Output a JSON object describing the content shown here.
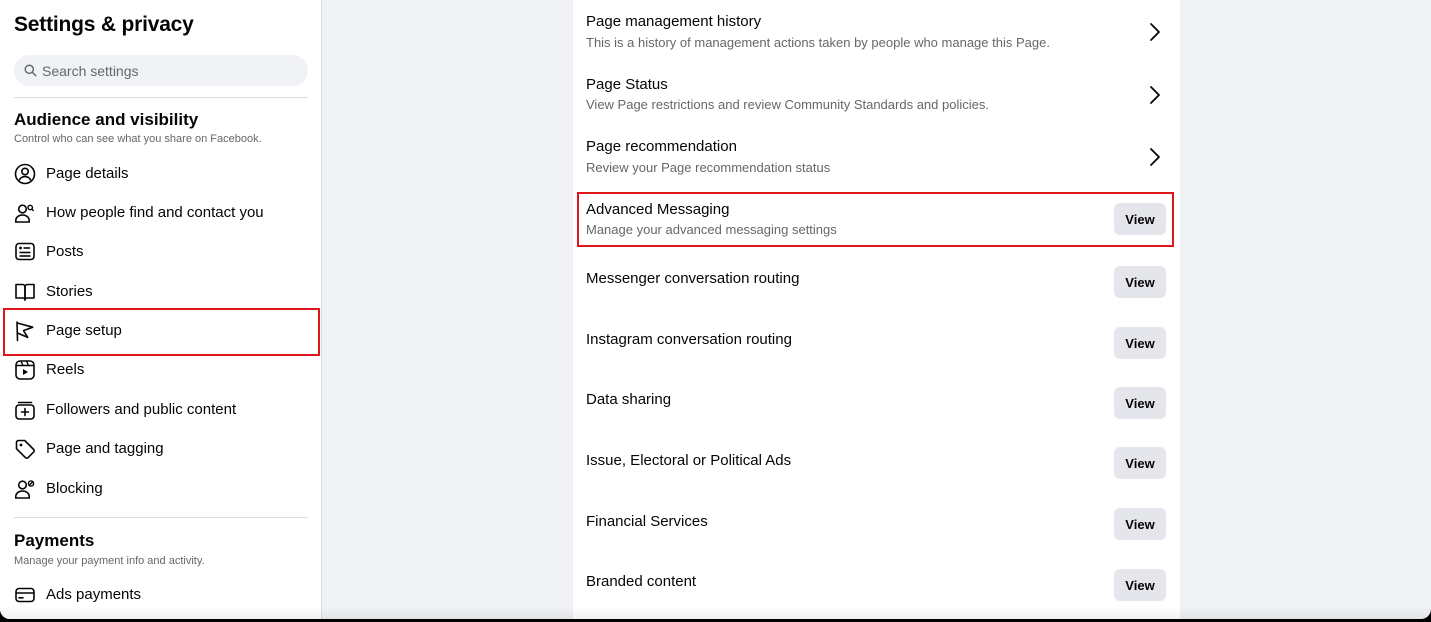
{
  "sidebar": {
    "title": "Settings & privacy",
    "search_placeholder": "Search settings",
    "sections": [
      {
        "title": "Audience and visibility",
        "subtitle": "Control who can see what you share on Facebook.",
        "items": [
          {
            "label": "Page details",
            "icon": "user-circle-icon"
          },
          {
            "label": "How people find and contact you",
            "icon": "person-search-icon"
          },
          {
            "label": "Posts",
            "icon": "posts-icon"
          },
          {
            "label": "Stories",
            "icon": "book-icon"
          },
          {
            "label": "Page setup",
            "icon": "flag-icon",
            "highlighted": true
          },
          {
            "label": "Reels",
            "icon": "reels-icon"
          },
          {
            "label": "Followers and public content",
            "icon": "followers-icon"
          },
          {
            "label": "Page and tagging",
            "icon": "tag-icon"
          },
          {
            "label": "Blocking",
            "icon": "block-user-icon"
          }
        ]
      },
      {
        "title": "Payments",
        "subtitle": "Manage your payment info and activity.",
        "items": [
          {
            "label": "Ads payments",
            "icon": "credit-card-icon"
          }
        ]
      }
    ]
  },
  "main": {
    "rows": [
      {
        "title": "Page management history",
        "description": "This is a history of management actions taken by people who manage this Page.",
        "action": "chevron"
      },
      {
        "title": "Page Status",
        "description": "View Page restrictions and review Community Standards and policies.",
        "action": "chevron"
      },
      {
        "title": "Page recommendation",
        "description": "Review your Page recommendation status",
        "action": "chevron"
      },
      {
        "title": "Advanced Messaging",
        "description": "Manage your advanced messaging settings",
        "action": "View",
        "highlighted": true
      },
      {
        "title": "Messenger conversation routing",
        "action": "View"
      },
      {
        "title": "Instagram conversation routing",
        "action": "View"
      },
      {
        "title": "Data sharing",
        "action": "View"
      },
      {
        "title": "Issue, Electoral or Political Ads",
        "action": "View"
      },
      {
        "title": "Financial Services",
        "action": "View"
      },
      {
        "title": "Branded content",
        "action": "View"
      }
    ]
  },
  "colors": {
    "highlight": "#e0151b",
    "secondary_text": "#65676b",
    "button_bg": "#e4e6eb"
  }
}
